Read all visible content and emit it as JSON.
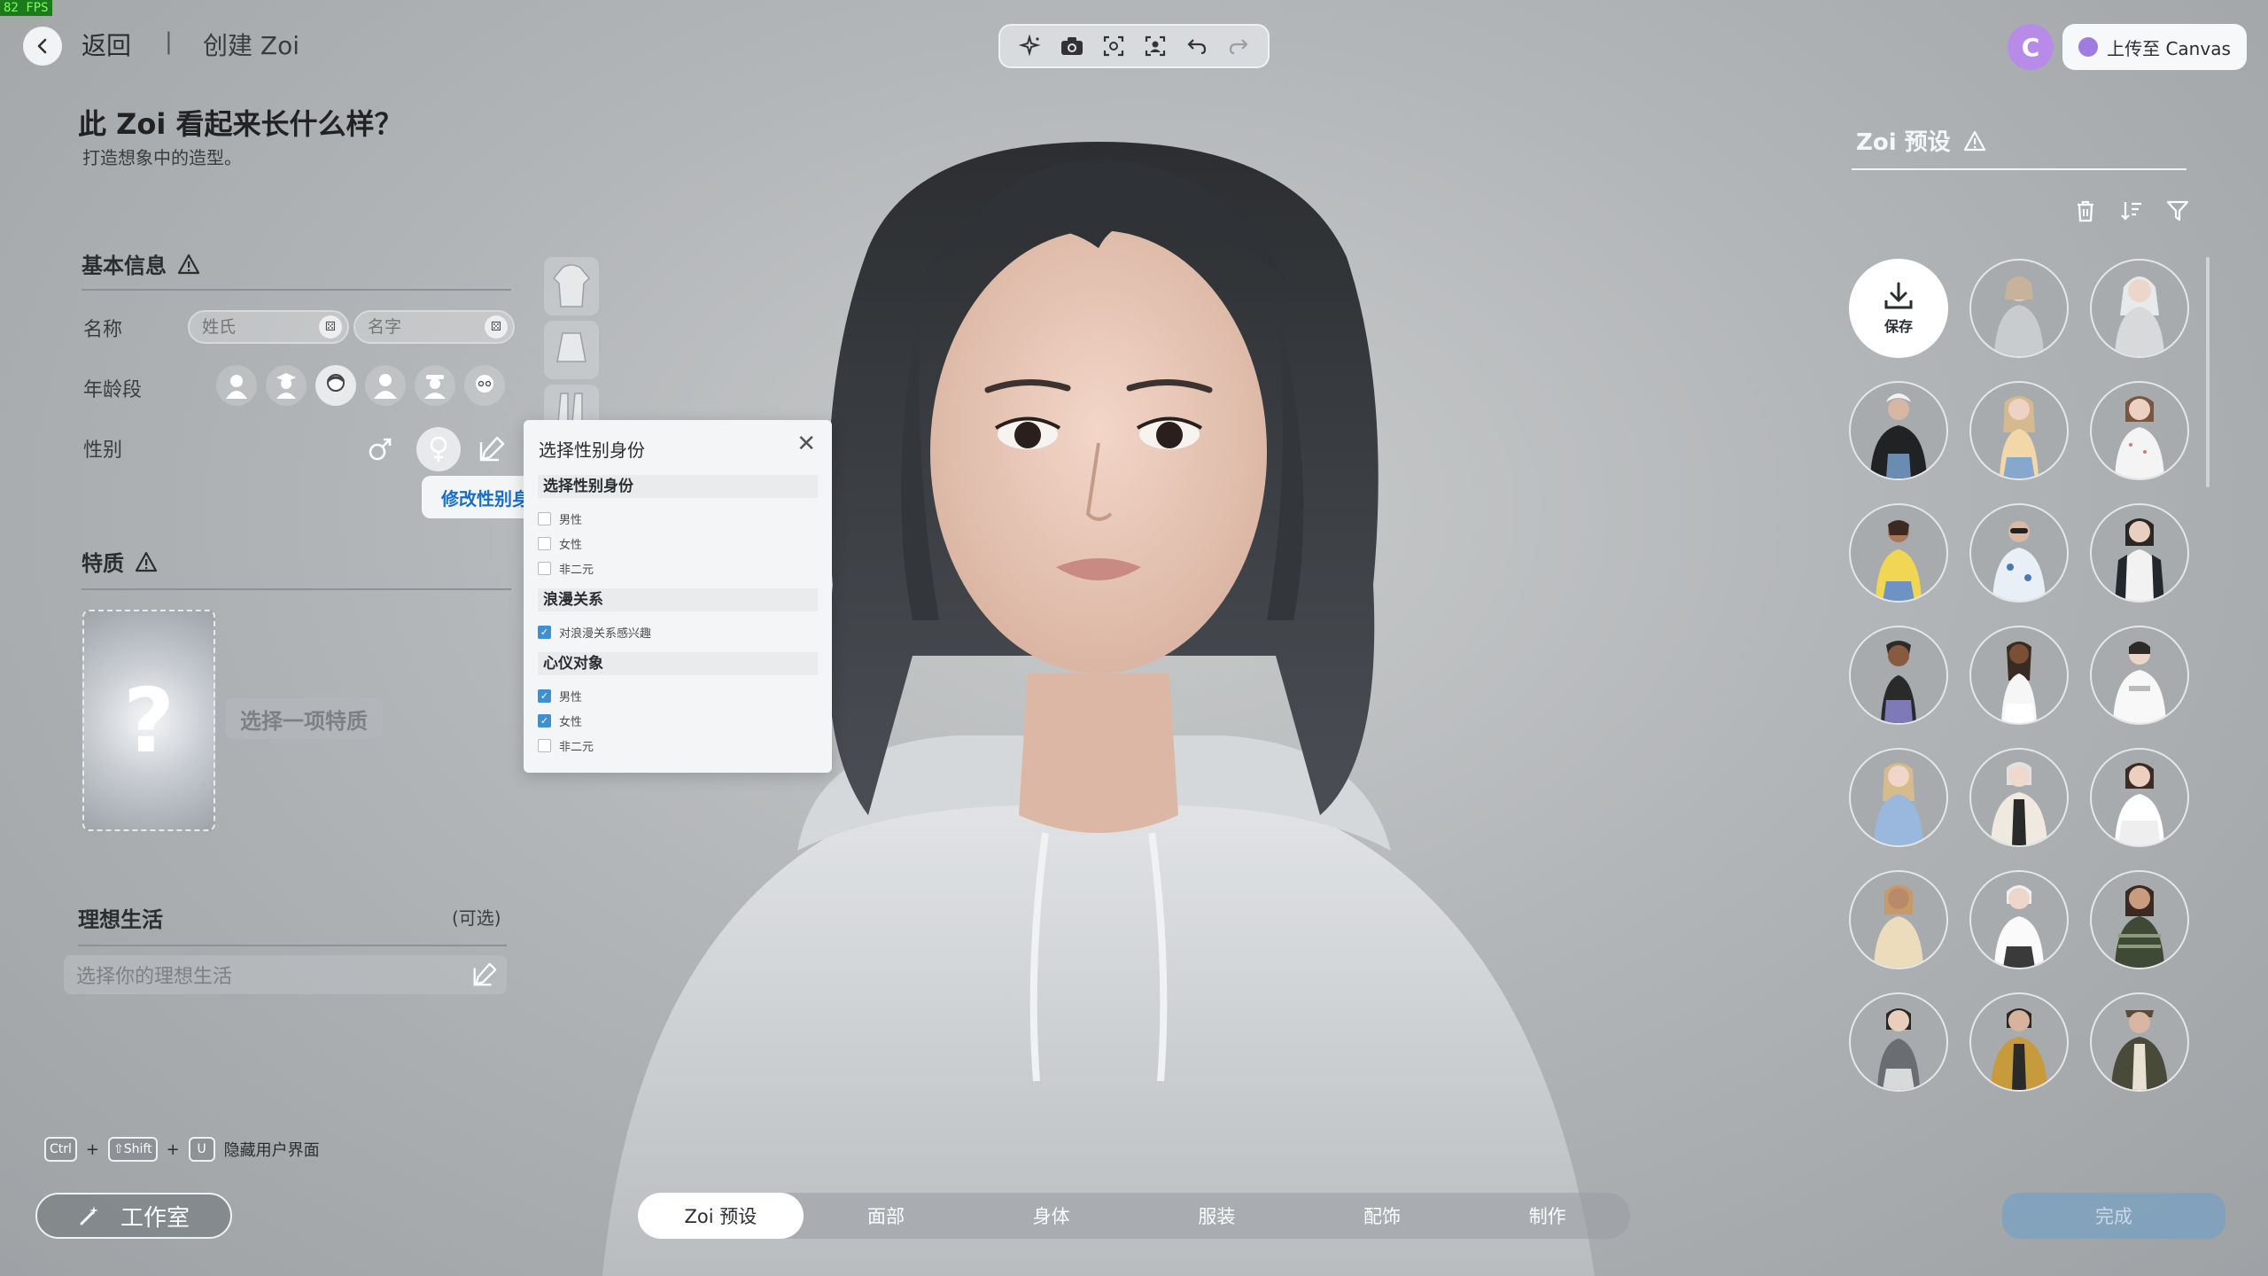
{
  "fps": "82 FPS",
  "topbar": {
    "back_label": "返回",
    "separator": "|",
    "title": "创建 Zoi",
    "upload_label": "上传至 Canvas",
    "canvas_avatar": "C"
  },
  "header": {
    "title": "此 Zoi 看起来长什么样？",
    "subtitle": "打造想象中的造型。"
  },
  "basic": {
    "title": "基本信息",
    "name_label": "名称",
    "surname_placeholder": "姓氏",
    "given_placeholder": "名字",
    "age_label": "年龄段",
    "gender_label": "性别",
    "edit_tooltip": "修改性别身份"
  },
  "traits": {
    "title": "特质",
    "placeholder_glyph": "?",
    "choose_label": "选择一项特质"
  },
  "ideal": {
    "title": "理想生活",
    "optional": "(可选)",
    "placeholder": "选择你的理想生活"
  },
  "hotkeys": {
    "ctrl": "Ctrl",
    "plus": "+",
    "shift": "⇧Shift",
    "u": "U",
    "label": "隐藏用户界面"
  },
  "studio_label": "工作室",
  "popup": {
    "title": "选择性别身份",
    "close": "✕",
    "group1": "选择性别身份",
    "g1_opt1": "男性",
    "g1_opt2": "女性",
    "g1_opt3": "非二元",
    "group2": "浪漫关系",
    "g2_opt1": "对浪漫关系感兴趣",
    "group3": "心仪对象",
    "g3_opt1": "男性",
    "g3_opt2": "女性",
    "g3_opt3": "非二元"
  },
  "presets": {
    "title": "Zoi 预设",
    "save_label": "保存"
  },
  "tabs": [
    "Zoi 预设",
    "面部",
    "身体",
    "服装",
    "配饰",
    "制作"
  ],
  "done_label": "完成",
  "colors": {
    "accent_blue": "#1a6fc4",
    "checkbox_blue": "#3f8fd3",
    "canvas_purple": "#b98be8"
  }
}
